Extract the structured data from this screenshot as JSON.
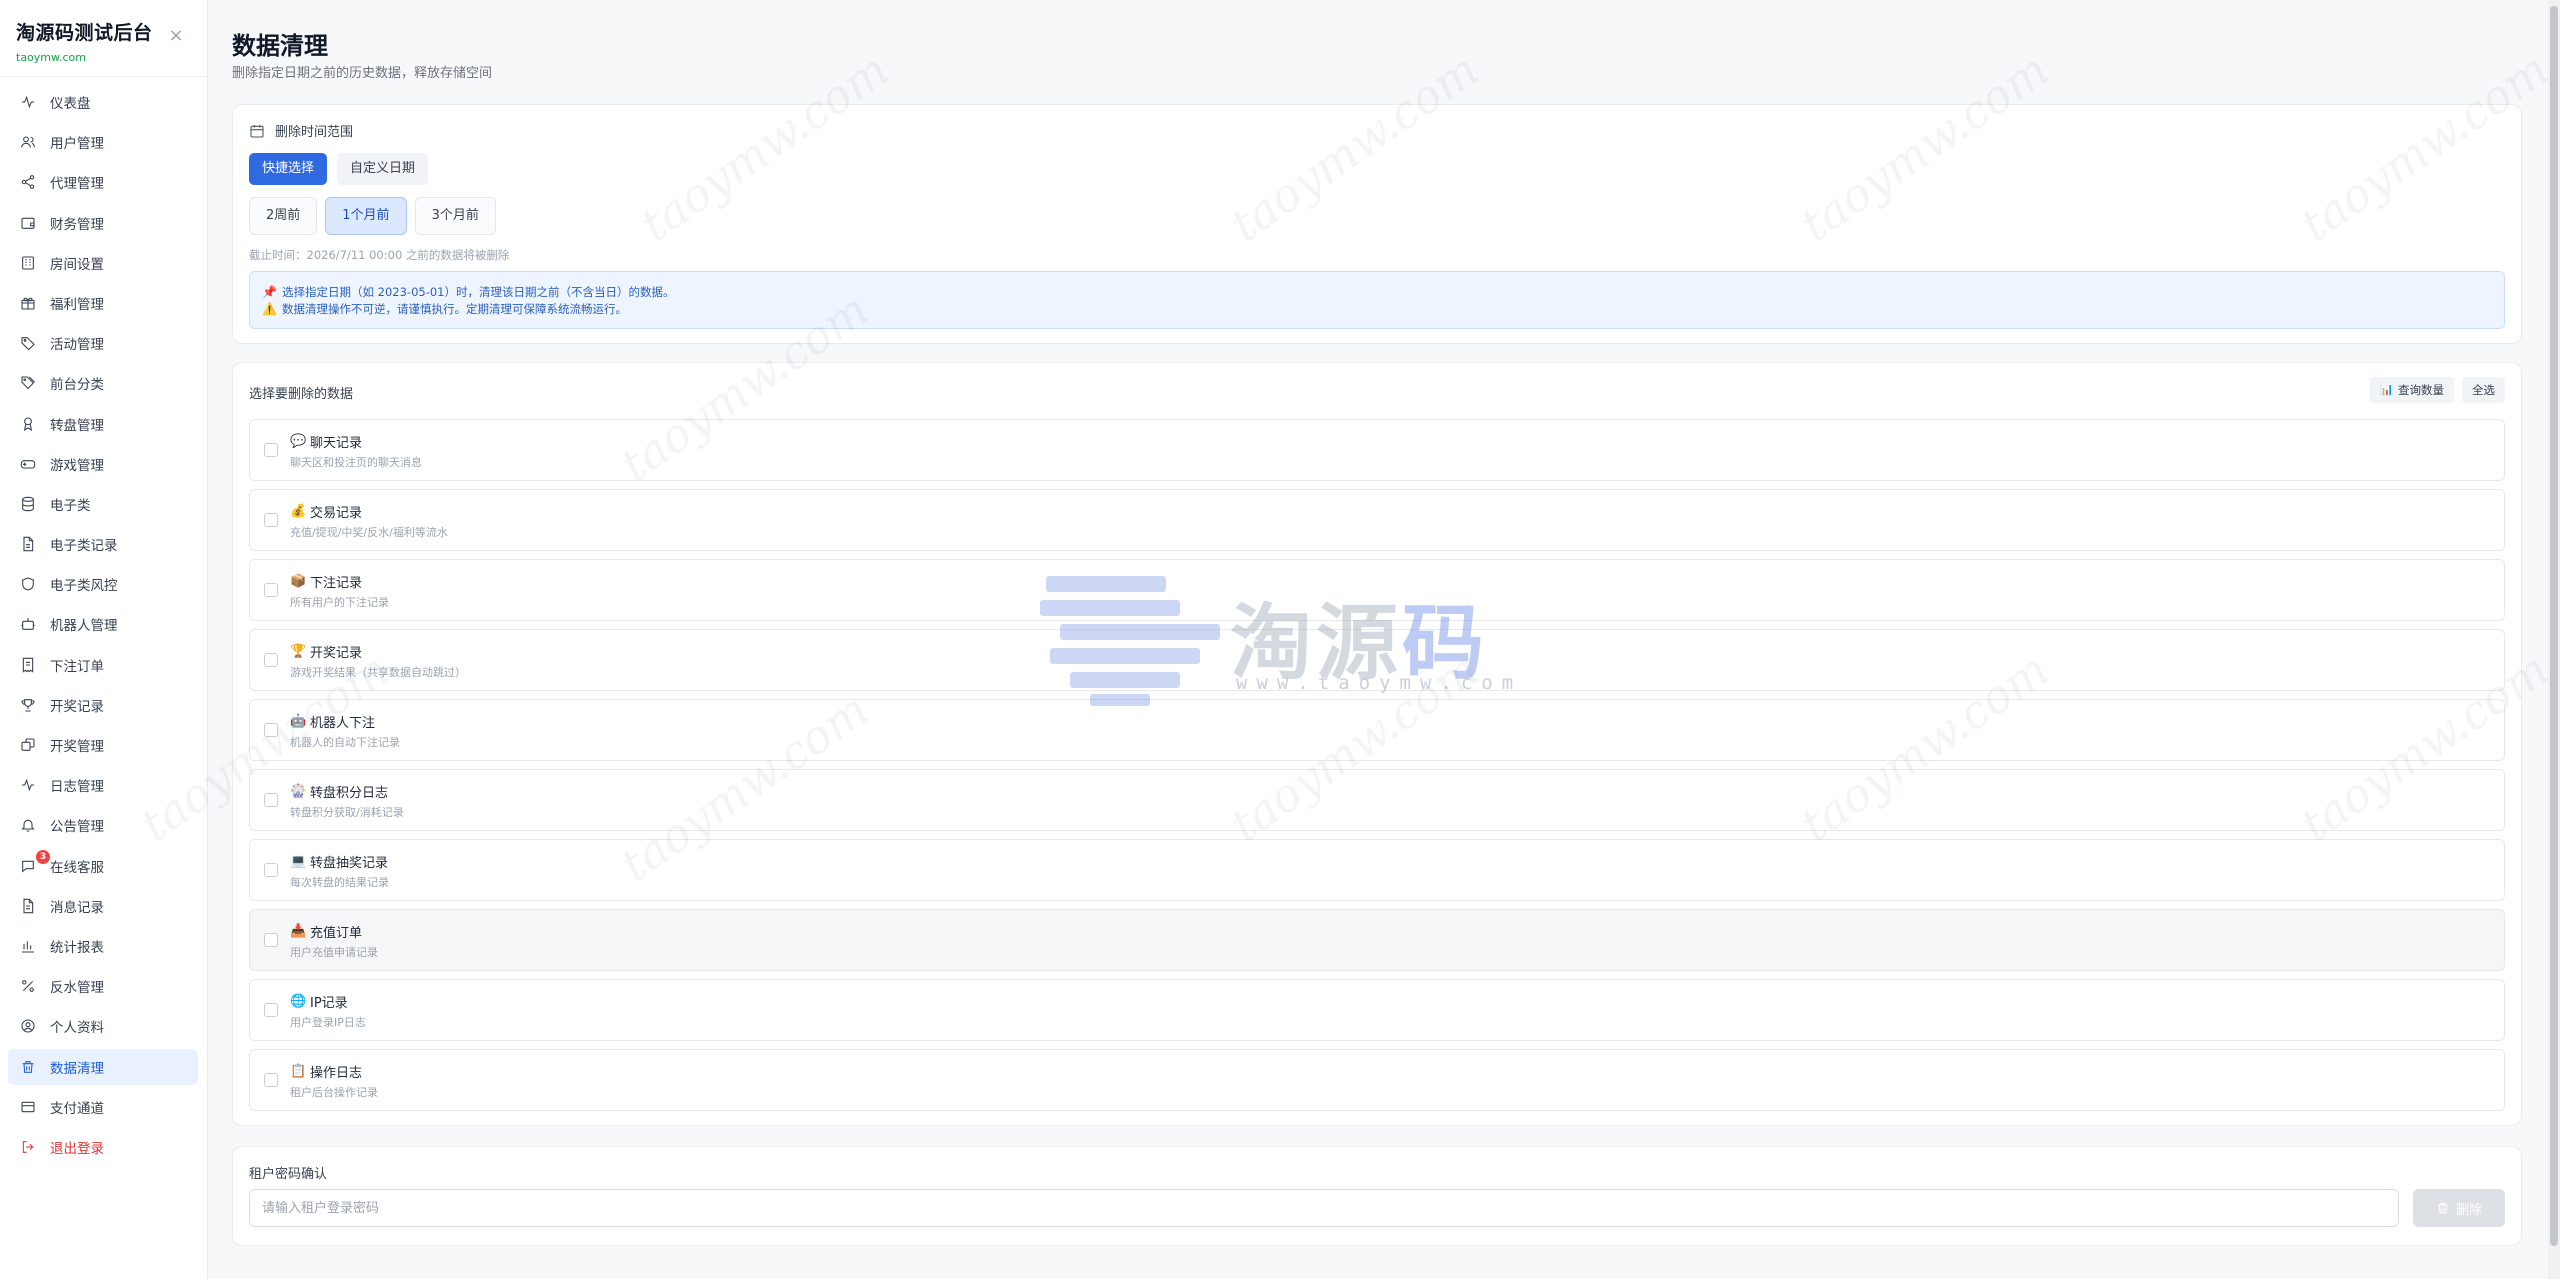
{
  "sidebar": {
    "brand_title": "淘源码测试后台",
    "brand_sub": "taoymw.com",
    "close_glyph": "×",
    "items": [
      {
        "label": "仪表盘",
        "icon": "activity-icon"
      },
      {
        "label": "用户管理",
        "icon": "users-icon"
      },
      {
        "label": "代理管理",
        "icon": "share-icon"
      },
      {
        "label": "财务管理",
        "icon": "wallet-icon"
      },
      {
        "label": "房间设置",
        "icon": "building-icon"
      },
      {
        "label": "福利管理",
        "icon": "gift-icon"
      },
      {
        "label": "活动管理",
        "icon": "tag-icon"
      },
      {
        "label": "前台分类",
        "icon": "tags-icon"
      },
      {
        "label": "转盘管理",
        "icon": "award-icon"
      },
      {
        "label": "游戏管理",
        "icon": "gamepad-icon"
      },
      {
        "label": "电子类",
        "icon": "database-icon"
      },
      {
        "label": "电子类记录",
        "icon": "file-icon"
      },
      {
        "label": "电子类风控",
        "icon": "shield-icon"
      },
      {
        "label": "机器人管理",
        "icon": "bot-icon"
      },
      {
        "label": "下注订单",
        "icon": "receipt-icon"
      },
      {
        "label": "开奖记录",
        "icon": "trophy-icon"
      },
      {
        "label": "开奖管理",
        "icon": "dice-icon"
      },
      {
        "label": "日志管理",
        "icon": "pulse-icon"
      },
      {
        "label": "公告管理",
        "icon": "bell-icon"
      },
      {
        "label": "在线客服",
        "icon": "chat-icon",
        "badge": "3"
      },
      {
        "label": "消息记录",
        "icon": "document-icon"
      },
      {
        "label": "统计报表",
        "icon": "bar-chart-icon"
      },
      {
        "label": "反水管理",
        "icon": "percent-icon"
      },
      {
        "label": "个人资料",
        "icon": "user-circle-icon"
      },
      {
        "label": "数据清理",
        "icon": "trash-icon",
        "active": true
      },
      {
        "label": "支付通道",
        "icon": "card-icon"
      },
      {
        "label": "退出登录",
        "icon": "logout-icon",
        "danger": true
      }
    ]
  },
  "page": {
    "title": "数据清理",
    "subtitle": "删除指定日期之前的历史数据，释放存储空间"
  },
  "range": {
    "label": "删除时间范围",
    "tabs": [
      "快捷选择",
      "自定义日期"
    ],
    "chips": [
      "2周前",
      "1个月前",
      "3个月前"
    ],
    "selected_chip": "1个月前",
    "cutoff_note": "截止时间：2026/7/11 00:00 之前的数据将被删除",
    "notice": [
      {
        "icon": "📌",
        "text": "选择指定日期（如 2023-05-01）时，清理该日期之前（不含当日）的数据。"
      },
      {
        "icon": "⚠️",
        "text": "数据清理操作不可逆，请谨慎执行。定期清理可保障系统流畅运行。"
      }
    ]
  },
  "data_select": {
    "label": "选择要删除的数据",
    "query_btn": "查询数量",
    "query_icon": "📊",
    "select_all_btn": "全选",
    "items": [
      {
        "emoji": "💬",
        "title": "聊天记录",
        "desc": "聊天区和投注页的聊天消息"
      },
      {
        "emoji": "💰",
        "title": "交易记录",
        "desc": "充值/提现/中奖/反水/福利等流水"
      },
      {
        "emoji": "📦",
        "title": "下注记录",
        "desc": "所有用户的下注记录"
      },
      {
        "emoji": "🏆",
        "title": "开奖记录",
        "desc": "游戏开奖结果（共享数据自动跳过）"
      },
      {
        "emoji": "🤖",
        "title": "机器人下注",
        "desc": "机器人的自动下注记录"
      },
      {
        "emoji": "🎡",
        "title": "转盘积分日志",
        "desc": "转盘积分获取/消耗记录"
      },
      {
        "emoji": "💻",
        "title": "转盘抽奖记录",
        "desc": "每次转盘的结果记录"
      },
      {
        "emoji": "📥",
        "title": "充值订单",
        "desc": "用户充值申请记录"
      },
      {
        "emoji": "🌐",
        "title": "IP记录",
        "desc": "用户登录IP日志"
      },
      {
        "emoji": "📋",
        "title": "操作日志",
        "desc": "租户后台操作记录"
      }
    ]
  },
  "password": {
    "label": "租户密码确认",
    "placeholder": "请输入租户登录密码",
    "delete_btn": "删除"
  },
  "watermark": {
    "text": "taoymw.com",
    "logo_text_a": "淘源",
    "logo_text_b": "码",
    "logo_url": "www.taoymw.com"
  },
  "colors": {
    "accent": "#2f6ae0",
    "active_nav_bg": "#eaf1fe",
    "danger": "#e0363a",
    "brand_sub": "#10a34a"
  }
}
